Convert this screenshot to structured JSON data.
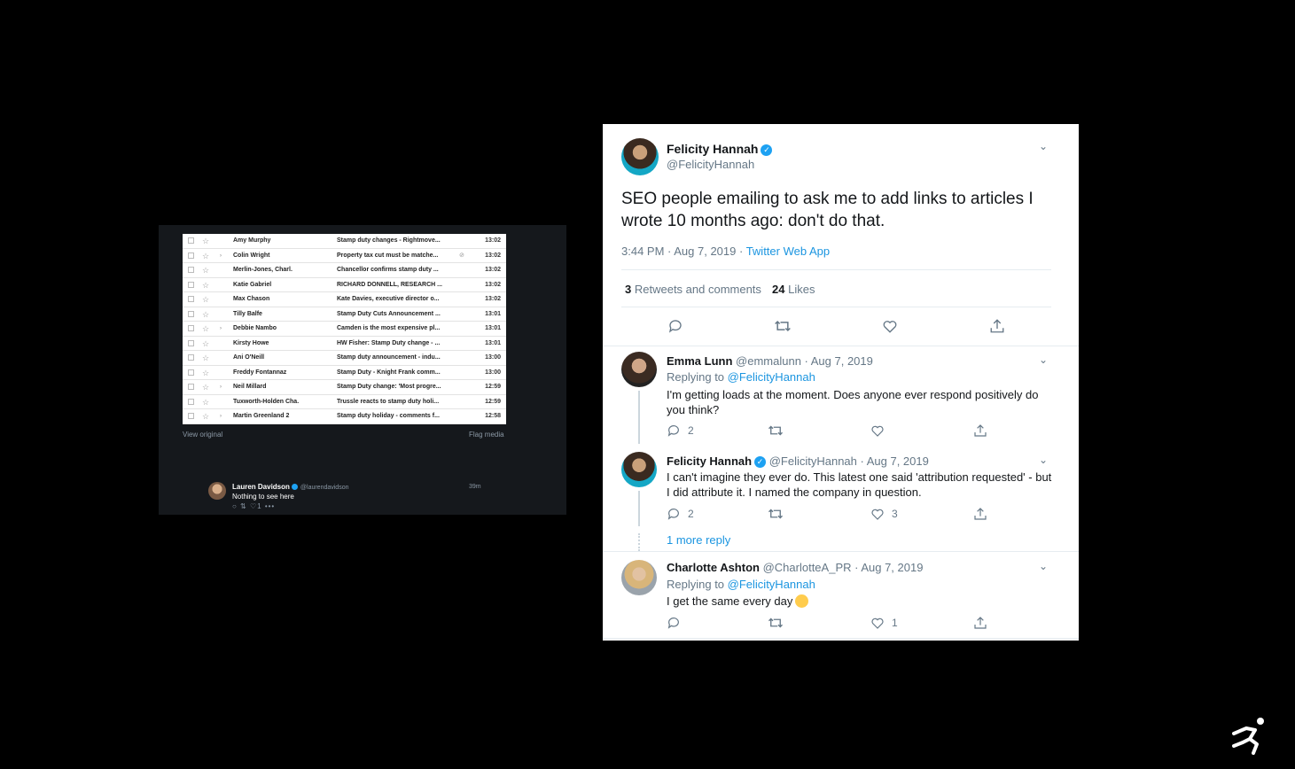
{
  "gmail": {
    "rows": [
      {
        "sender": "Amy Murphy",
        "subject": "Stamp duty changes - Rightmove...",
        "time": "13:02",
        "important": false,
        "attachment": false
      },
      {
        "sender": "Colin Wright",
        "subject": "Property tax cut must be matche...",
        "time": "13:02",
        "important": true,
        "attachment": true
      },
      {
        "sender": "Merlin-Jones, Charl.",
        "subject": "Chancellor confirms stamp duty ...",
        "time": "13:02",
        "important": false,
        "attachment": false
      },
      {
        "sender": "Katie Gabriel",
        "subject": "RICHARD DONNELL, RESEARCH ...",
        "time": "13:02",
        "important": false,
        "attachment": false
      },
      {
        "sender": "Max Chason",
        "subject": "Kate Davies, executive director o...",
        "time": "13:02",
        "important": false,
        "attachment": false
      },
      {
        "sender": "Tilly Balfe",
        "subject": "Stamp Duty Cuts Announcement ...",
        "time": "13:01",
        "important": false,
        "attachment": false
      },
      {
        "sender": "Debbie Nambo",
        "subject": "Camden is the most expensive pl...",
        "time": "13:01",
        "important": true,
        "attachment": false
      },
      {
        "sender": "Kirsty Howe",
        "subject": "HW Fisher: Stamp Duty change - ...",
        "time": "13:01",
        "important": false,
        "attachment": false
      },
      {
        "sender": "Ani O'Neill",
        "subject": "Stamp duty announcement - indu...",
        "time": "13:00",
        "important": false,
        "attachment": false
      },
      {
        "sender": "Freddy Fontannaz",
        "subject": "Stamp Duty - Knight Frank comm...",
        "time": "13:00",
        "important": false,
        "attachment": false
      },
      {
        "sender": "Neil Millard",
        "subject": "Stamp Duty change: 'Most progre...",
        "time": "12:59",
        "important": true,
        "attachment": false
      },
      {
        "sender": "Tuxworth-Holden Cha.",
        "subject": "Trussle reacts to stamp duty holi...",
        "time": "12:59",
        "important": false,
        "attachment": false
      },
      {
        "sender": "Martin Greenland 2",
        "subject": "Stamp duty holiday - comments f...",
        "time": "12:58",
        "important": true,
        "attachment": false
      }
    ],
    "view_original": "View original",
    "flag_media": "Flag media"
  },
  "mini_tweet": {
    "name": "Lauren Davidson",
    "handle": "@laurendavidson",
    "time": "39m",
    "text": "Nothing to see here",
    "actions": "○ ⇅ ♡1 •••"
  },
  "main_tweet": {
    "name": "Felicity Hannah",
    "handle": "@FelicityHannah",
    "text": "SEO people emailing to ask me to add links to articles I wrote 10 months ago: don't do that.",
    "timestamp": "3:44 PM · Aug 7, 2019 · ",
    "source": "Twitter Web App",
    "retweet_count": "3",
    "retweet_label": "Retweets and comments",
    "like_count": "24",
    "like_label": "Likes"
  },
  "replies": [
    {
      "name": "Emma Lunn",
      "meta": "@emmalunn · Aug 7, 2019",
      "replying_prefix": "Replying to ",
      "replying_to": "@FelicityHannah",
      "text": "I'm getting loads at the moment. Does anyone ever respond positively do you think?",
      "reply_count": "2",
      "like_count": ""
    },
    {
      "name": "Felicity Hannah",
      "meta": "@FelicityHannah · Aug 7, 2019",
      "text": "I can't imagine they ever do. This latest one said 'attribution requested' - but I did attribute it. I named the company in question.",
      "reply_count": "2",
      "like_count": "3",
      "more": "1 more reply"
    },
    {
      "name": "Charlotte Ashton",
      "meta": "@CharlotteA_PR · Aug 7, 2019",
      "replying_prefix": "Replying to ",
      "replying_to": "@FelicityHannah",
      "text": "I get the same every day",
      "reply_count": "",
      "like_count": "1"
    }
  ],
  "colors": {
    "link": "#1b95e0",
    "verified": "#1da1f2",
    "muted": "#657786"
  },
  "icons": [
    "reply-icon",
    "retweet-icon",
    "like-icon",
    "share-icon",
    "chevron-down-icon",
    "verified-icon"
  ]
}
